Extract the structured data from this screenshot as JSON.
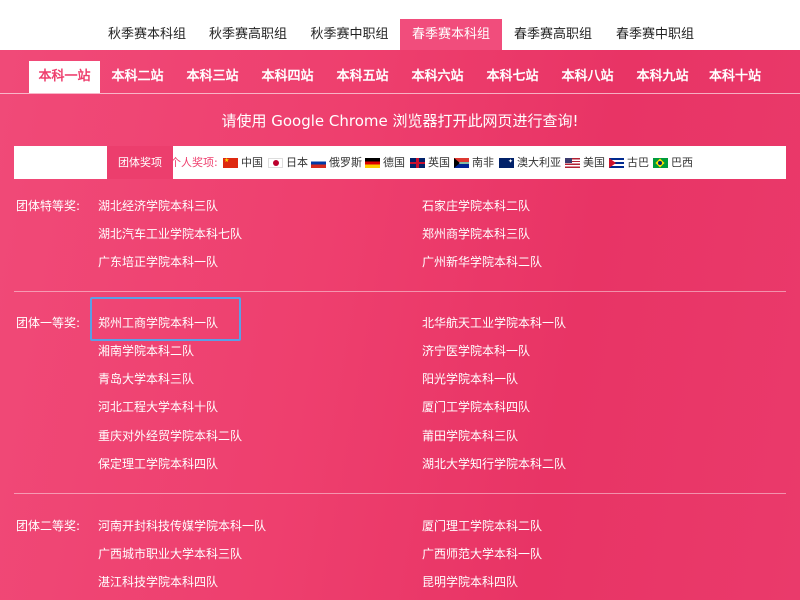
{
  "season_tabs": [
    {
      "label": "秋季赛本科组",
      "active": false
    },
    {
      "label": "秋季赛高职组",
      "active": false
    },
    {
      "label": "秋季赛中职组",
      "active": false
    },
    {
      "label": "春季赛本科组",
      "active": true
    },
    {
      "label": "春季赛高职组",
      "active": false
    },
    {
      "label": "春季赛中职组",
      "active": false
    }
  ],
  "station_tabs": [
    {
      "label": "本科一站",
      "active": true
    },
    {
      "label": "本科二站",
      "active": false
    },
    {
      "label": "本科三站",
      "active": false
    },
    {
      "label": "本科四站",
      "active": false
    },
    {
      "label": "本科五站",
      "active": false
    },
    {
      "label": "本科六站",
      "active": false
    },
    {
      "label": "本科七站",
      "active": false
    },
    {
      "label": "本科八站",
      "active": false
    },
    {
      "label": "本科九站",
      "active": false
    },
    {
      "label": "本科十站",
      "active": false
    }
  ],
  "notice": "请使用 Google Chrome 浏览器打开此网页进行查询!",
  "filter": {
    "team_award": "团体奖项",
    "personal_label": "个人奖项:",
    "countries": [
      {
        "name": "中国",
        "flag": "flag-cn"
      },
      {
        "name": "日本",
        "flag": "flag-jp"
      },
      {
        "name": "俄罗斯",
        "flag": "flag-ru"
      },
      {
        "name": "德国",
        "flag": "flag-de"
      },
      {
        "name": "英国",
        "flag": "flag-gb"
      },
      {
        "name": "南非",
        "flag": "flag-za"
      },
      {
        "name": "澳大利亚",
        "flag": "flag-au"
      },
      {
        "name": "美国",
        "flag": "flag-us"
      },
      {
        "name": "古巴",
        "flag": "flag-cu"
      },
      {
        "name": "巴西",
        "flag": "flag-br"
      }
    ]
  },
  "awards": {
    "special": {
      "label": "团体特等奖:",
      "left": [
        "湖北经济学院本科三队",
        "湖北汽车工业学院本科七队",
        "广东培正学院本科一队"
      ],
      "right": [
        "石家庄学院本科二队",
        "郑州商学院本科三队",
        "广州新华学院本科二队"
      ]
    },
    "first": {
      "label": "团体一等奖:",
      "left": [
        "郑州工商学院本科一队",
        "湘南学院本科二队",
        "青岛大学本科三队",
        "河北工程大学本科十队",
        "重庆对外经贸学院本科二队",
        "保定理工学院本科四队"
      ],
      "right": [
        "北华航天工业学院本科一队",
        "济宁医学院本科一队",
        "阳光学院本科一队",
        "厦门工学院本科四队",
        "莆田学院本科三队",
        "湖北大学知行学院本科二队"
      ]
    },
    "second": {
      "label": "团体二等奖:",
      "left": [
        "河南开封科技传媒学院本科一队",
        "广西城市职业大学本科三队",
        "湛江科技学院本科四队"
      ],
      "right": [
        "厦门理工学院本科二队",
        "广西师范大学本科一队",
        "昆明学院本科四队"
      ]
    }
  },
  "colors": {
    "accent": "#ee3f6e",
    "highlight": "#5aa0e6"
  }
}
